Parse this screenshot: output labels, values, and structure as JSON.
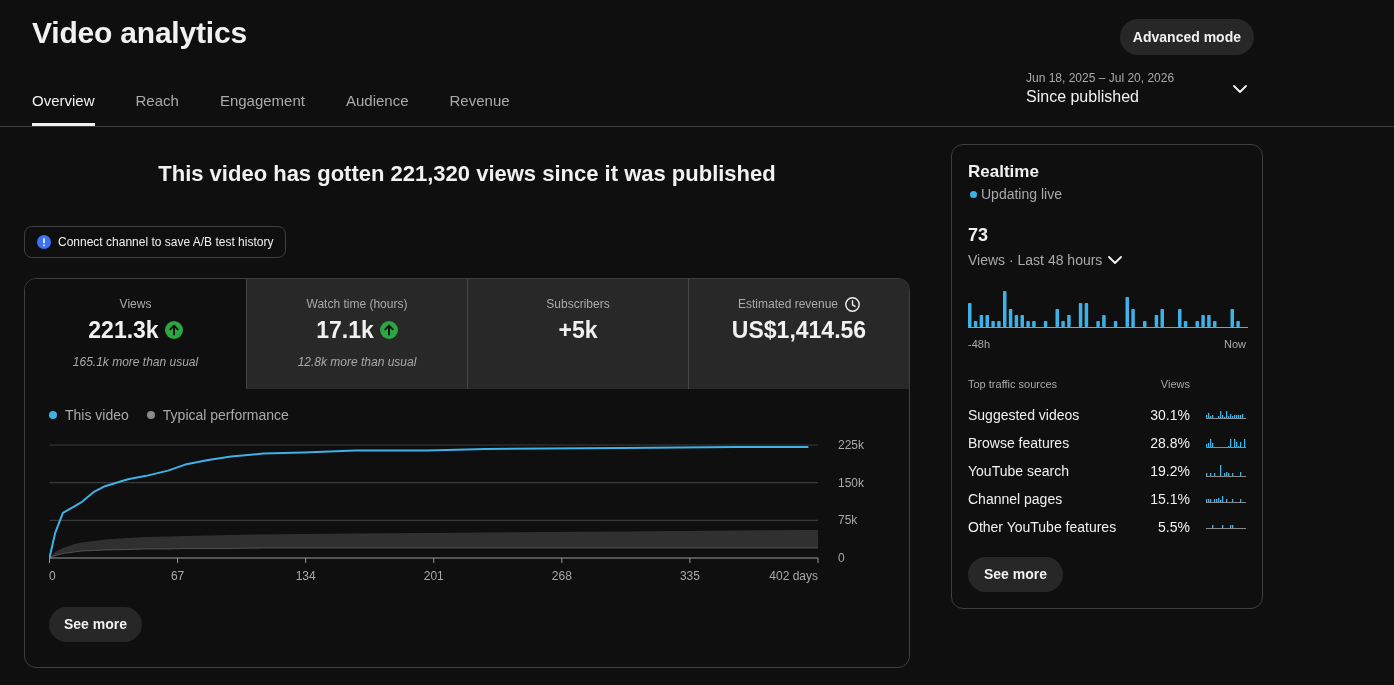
{
  "header": {
    "title": "Video analytics",
    "advanced_button": "Advanced mode",
    "tabs": [
      {
        "label": "Overview",
        "selected": true
      },
      {
        "label": "Reach",
        "selected": false
      },
      {
        "label": "Engagement",
        "selected": false
      },
      {
        "label": "Audience",
        "selected": false
      },
      {
        "label": "Revenue",
        "selected": false
      }
    ],
    "date_range": {
      "range": "Jun 18, 2025 – Jul 20, 2026",
      "label": "Since published"
    }
  },
  "headline": "This video has gotten 221,320 views since it was published",
  "notice": {
    "text": "Connect channel to save A/B test history"
  },
  "metrics": [
    {
      "kind": "count",
      "label": "Views",
      "value": "221.3k",
      "trending_up": true,
      "note": "165.1k more than usual",
      "selected": true
    },
    {
      "kind": "count",
      "label": "Watch time (hours)",
      "value": "17.1k",
      "trending_up": true,
      "note": "12.8k more than usual",
      "selected": false
    },
    {
      "kind": "count",
      "label": "Subscribers",
      "value": "+5k",
      "trending_up": false,
      "selected": false
    },
    {
      "kind": "revenue",
      "label": "Estimated revenue",
      "value": "US$1,414.56",
      "trending_up": false,
      "selected": false
    }
  ],
  "chart": {
    "chart_data": {
      "type": "line",
      "x": [
        0,
        3,
        7,
        13,
        17,
        23,
        29,
        41,
        50,
        62,
        71,
        83,
        95,
        112,
        133,
        160,
        198,
        228,
        300,
        359,
        397,
        402
      ],
      "series": [
        {
          "name": "This video",
          "color": "#3eb1e6",
          "values": [
            0,
            50000,
            90000,
            103000,
            112000,
            131000,
            143000,
            157000,
            163000,
            174000,
            186000,
            195000,
            202000,
            208000,
            210000,
            214000,
            214000,
            217000,
            219000,
            221000,
            221000,
            null
          ]
        },
        {
          "name": "Typical performance",
          "color": "#8a8a8a",
          "type": "area",
          "values": [
            0,
            12000,
            20000,
            28000,
            31000,
            34000,
            37000,
            40000,
            42000,
            43000,
            44000,
            45000,
            46000,
            47000,
            48000,
            49000,
            50000,
            51000,
            53000,
            55000,
            56000,
            56000
          ]
        },
        {
          "color": "#8a8a8a",
          "type": "line",
          "values": [
            0,
            5000,
            9000,
            12000,
            14000,
            15000,
            16000,
            17000,
            18000,
            18000,
            19000,
            19000,
            19000,
            20000,
            20000,
            20000,
            20000,
            20000,
            20000,
            20000,
            20000,
            20000
          ]
        }
      ],
      "xlim": [
        0,
        402
      ],
      "ylim": [
        0,
        225000
      ],
      "xticks": [
        0,
        67,
        134,
        201,
        268,
        335,
        {
          "value": 402,
          "label": "402 days"
        }
      ],
      "yticks": [
        0,
        {
          "value": 75000,
          "label": "75k"
        },
        {
          "value": 150000,
          "label": "150k"
        },
        {
          "value": 225000,
          "label": "225k"
        }
      ]
    },
    "see_more_button": "See more"
  },
  "realtime": {
    "title": "Realtime",
    "status": "Updating live",
    "count": "73",
    "period": "Views · Last 48 hours",
    "axis_start": "-48h",
    "axis_end": "Now",
    "traffic": {
      "columns": [
        "Top traffic sources",
        "Views"
      ],
      "rows": [
        {
          "source": "Suggested videos",
          "share": "30.1%"
        },
        {
          "source": "Browse features",
          "share": "28.8%"
        },
        {
          "source": "YouTube search",
          "share": "19.2%"
        },
        {
          "source": "Channel pages",
          "share": "15.1%"
        },
        {
          "source": "Other YouTube features",
          "share": "5.5%"
        }
      ]
    },
    "see_more_button": "See more"
  }
}
